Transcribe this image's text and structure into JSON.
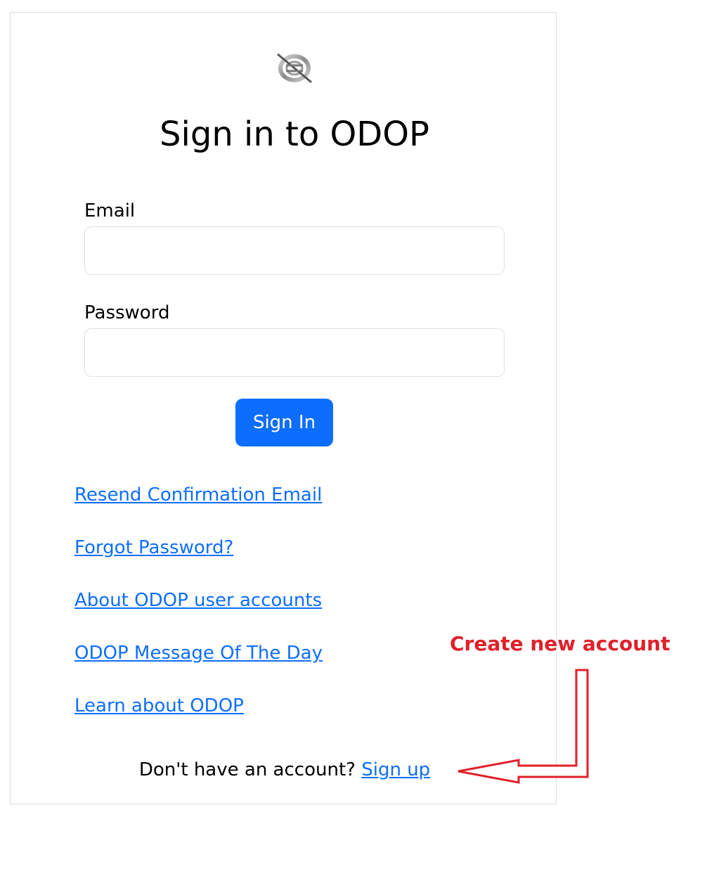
{
  "page": {
    "title": "Sign in to ODOP"
  },
  "form": {
    "email_label": "Email",
    "email_value": "",
    "email_placeholder": "",
    "password_label": "Password",
    "password_value": "",
    "password_placeholder": "",
    "submit_label": "Sign In"
  },
  "links": {
    "resend": "Resend Confirmation Email",
    "forgot": "Forgot Password?",
    "about": "About ODOP user accounts",
    "motd": "ODOP Message Of The Day",
    "learn": "Learn about ODOP"
  },
  "signup": {
    "prompt": "Don't have an account?",
    "link_label": "Sign up"
  },
  "annotation": {
    "text": "Create new account",
    "color": "#e0202a"
  },
  "colors": {
    "primary": "#0d6efd",
    "border": "#dee2e6"
  },
  "icons": {
    "logo": "odop-logo-icon"
  }
}
